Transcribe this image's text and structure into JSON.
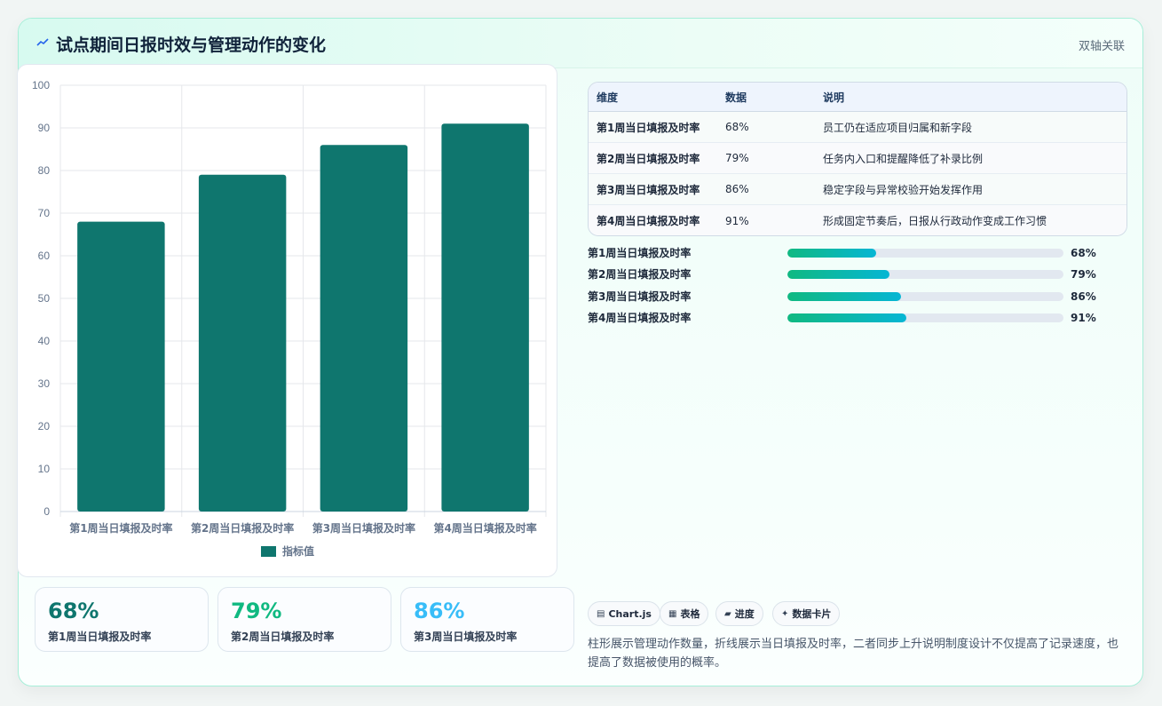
{
  "header": {
    "title": "试点期间日报时效与管理动作的变化",
    "badge": "双轴关联"
  },
  "colors": {
    "bar": "#0f766e",
    "accent_green": "#10b981",
    "accent_cyan": "#06b6d4",
    "stat1": "#0f766e",
    "stat2": "#10b981",
    "stat3": "#38bdf8"
  },
  "chart_data": {
    "type": "bar",
    "categories": [
      "第1周当日填报及时率",
      "第2周当日填报及时率",
      "第3周当日填报及时率",
      "第4周当日填报及时率"
    ],
    "series": [
      {
        "name": "指标值",
        "values": [
          68,
          79,
          86,
          91
        ]
      }
    ],
    "yticks": [
      "0",
      "10",
      "20",
      "30",
      "40",
      "50",
      "60",
      "70",
      "80",
      "90",
      "100"
    ],
    "ylim": [
      0,
      100
    ],
    "grid": true,
    "legend": "bottom"
  },
  "stats": [
    {
      "value": "68%",
      "label": "第1周当日填报及时率"
    },
    {
      "value": "79%",
      "label": "第2周当日填报及时率"
    },
    {
      "value": "86%",
      "label": "第3周当日填报及时率"
    }
  ],
  "table": {
    "headers": [
      "维度",
      "数据",
      "说明"
    ],
    "rows": [
      {
        "dim": "第1周当日填报及时率",
        "data": "68%",
        "note": "员工仍在适应项目归属和新字段"
      },
      {
        "dim": "第2周当日填报及时率",
        "data": "79%",
        "note": "任务内入口和提醒降低了补录比例"
      },
      {
        "dim": "第3周当日填报及时率",
        "data": "86%",
        "note": "稳定字段与异常校验开始发挥作用"
      },
      {
        "dim": "第4周当日填报及时率",
        "data": "91%",
        "note": "形成固定节奏后，日报从行政动作变成工作习惯"
      }
    ]
  },
  "progress": [
    {
      "label": "第1周当日填报及时率",
      "value": "68%",
      "fill": 0.32
    },
    {
      "label": "第2周当日填报及时率",
      "value": "79%",
      "fill": 0.37
    },
    {
      "label": "第3周当日填报及时率",
      "value": "86%",
      "fill": 0.41
    },
    {
      "label": "第4周当日填报及时率",
      "value": "91%",
      "fill": 0.43
    }
  ],
  "chips": [
    {
      "icon": "▤",
      "label": "Chart.js"
    },
    {
      "icon": "▦",
      "label": "表格"
    },
    {
      "icon": "▰",
      "label": "进度"
    },
    {
      "icon": "✦",
      "label": "数据卡片"
    }
  ],
  "footnote": "柱形展示管理动作数量，折线展示当日填报及时率，二者同步上升说明制度设计不仅提高了记录速度，也提高了数据被使用的概率。"
}
